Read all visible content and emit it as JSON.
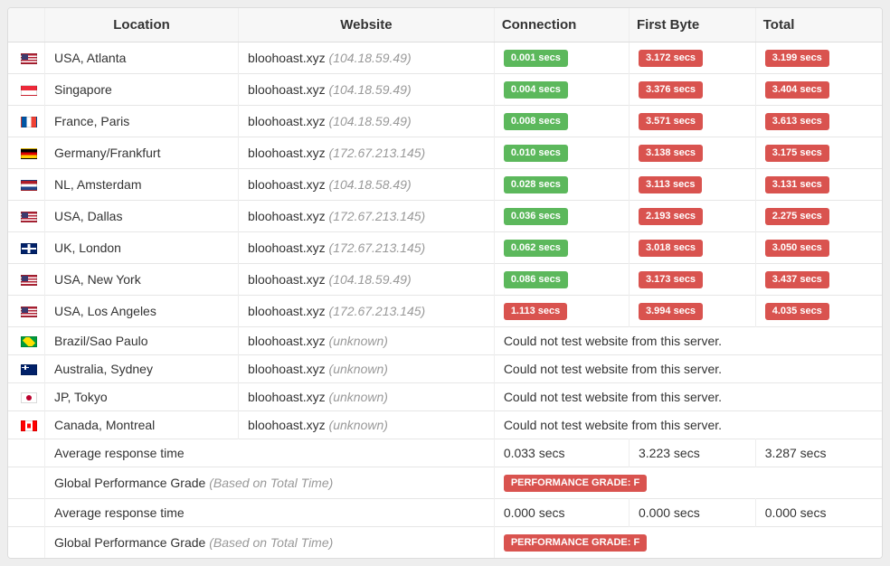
{
  "headers": {
    "location": "Location",
    "website": "Website",
    "connection": "Connection",
    "first_byte": "First Byte",
    "total": "Total"
  },
  "host": "bloohoast.xyz",
  "error_text": "Could not test website from this server.",
  "unknown_text": "(unknown)",
  "rows": [
    {
      "flag": "us",
      "location": "USA, Atlanta",
      "ip": "(104.18.59.49)",
      "conn": "0.001 secs",
      "conn_c": "green",
      "fb": "3.172 secs",
      "tot": "3.199 secs",
      "error": false
    },
    {
      "flag": "sg",
      "location": "Singapore",
      "ip": "(104.18.59.49)",
      "conn": "0.004 secs",
      "conn_c": "green",
      "fb": "3.376 secs",
      "tot": "3.404 secs",
      "error": false
    },
    {
      "flag": "fr",
      "location": "France, Paris",
      "ip": "(104.18.59.49)",
      "conn": "0.008 secs",
      "conn_c": "green",
      "fb": "3.571 secs",
      "tot": "3.613 secs",
      "error": false
    },
    {
      "flag": "de",
      "location": "Germany/Frankfurt",
      "ip": "(172.67.213.145)",
      "conn": "0.010 secs",
      "conn_c": "green",
      "fb": "3.138 secs",
      "tot": "3.175 secs",
      "error": false
    },
    {
      "flag": "nl",
      "location": "NL, Amsterdam",
      "ip": "(104.18.58.49)",
      "conn": "0.028 secs",
      "conn_c": "green",
      "fb": "3.113 secs",
      "tot": "3.131 secs",
      "error": false
    },
    {
      "flag": "us",
      "location": "USA, Dallas",
      "ip": "(172.67.213.145)",
      "conn": "0.036 secs",
      "conn_c": "green",
      "fb": "2.193 secs",
      "tot": "2.275 secs",
      "error": false
    },
    {
      "flag": "uk",
      "location": "UK, London",
      "ip": "(172.67.213.145)",
      "conn": "0.062 secs",
      "conn_c": "green",
      "fb": "3.018 secs",
      "tot": "3.050 secs",
      "error": false
    },
    {
      "flag": "us",
      "location": "USA, New York",
      "ip": "(104.18.59.49)",
      "conn": "0.086 secs",
      "conn_c": "green",
      "fb": "3.173 secs",
      "tot": "3.437 secs",
      "error": false
    },
    {
      "flag": "us",
      "location": "USA, Los Angeles",
      "ip": "(172.67.213.145)",
      "conn": "1.113 secs",
      "conn_c": "red",
      "fb": "3.994 secs",
      "tot": "4.035 secs",
      "error": false
    },
    {
      "flag": "br",
      "location": "Brazil/Sao Paulo",
      "ip": "(unknown)",
      "error": true
    },
    {
      "flag": "au",
      "location": "Australia, Sydney",
      "ip": "(unknown)",
      "error": true
    },
    {
      "flag": "jp",
      "location": "JP, Tokyo",
      "ip": "(unknown)",
      "error": true
    },
    {
      "flag": "ca",
      "location": "Canada, Montreal",
      "ip": "(unknown)",
      "error": true
    }
  ],
  "summary": [
    {
      "type": "avg",
      "label": "Average response time",
      "conn": "0.033 secs",
      "fb": "3.223 secs",
      "tot": "3.287 secs"
    },
    {
      "type": "grade",
      "label": "Global Performance Grade",
      "note": "(Based on Total Time)",
      "grade_label": "PERFORMANCE GRADE:",
      "grade": "F"
    },
    {
      "type": "avg",
      "label": "Average response time",
      "conn": "0.000 secs",
      "fb": "0.000 secs",
      "tot": "0.000 secs"
    },
    {
      "type": "grade",
      "label": "Global Performance Grade",
      "note": "(Based on Total Time)",
      "grade_label": "PERFORMANCE GRADE:",
      "grade": "F"
    }
  ]
}
